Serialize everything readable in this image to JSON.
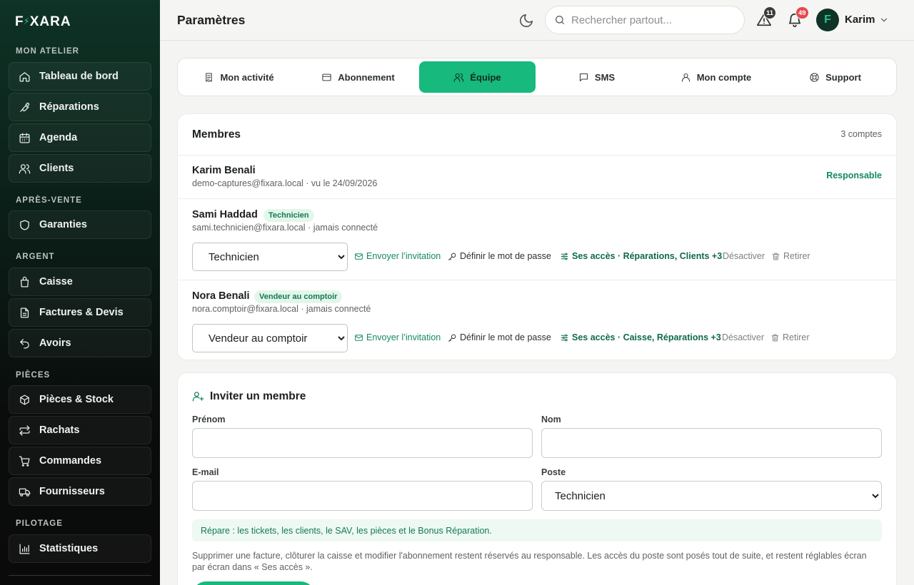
{
  "sidebar": {
    "brand": {
      "left": "F",
      "bolt": "⚡",
      "right": "XARA"
    },
    "sections": [
      {
        "title": "MON ATELIER"
      },
      {
        "title": "APRÈS-VENTE"
      },
      {
        "title": "ARGENT"
      },
      {
        "title": "PIÈCES"
      },
      {
        "title": "PILOTAGE"
      }
    ],
    "items": [
      {
        "label": "Tableau de bord",
        "icon": "home-icon"
      },
      {
        "label": "Réparations",
        "icon": "wrench-icon"
      },
      {
        "label": "Agenda",
        "icon": "calendar-icon"
      },
      {
        "label": "Clients",
        "icon": "users-icon"
      },
      {
        "label": "Garanties",
        "icon": "shield-icon"
      },
      {
        "label": "Caisse",
        "icon": "register-icon"
      },
      {
        "label": "Factures & Devis",
        "icon": "document-icon"
      },
      {
        "label": "Avoirs",
        "icon": "undo-icon"
      },
      {
        "label": "Pièces & Stock",
        "icon": "box-icon"
      },
      {
        "label": "Rachats",
        "icon": "exchange-icon"
      },
      {
        "label": "Commandes",
        "icon": "cart-icon"
      },
      {
        "label": "Fournisseurs",
        "icon": "truck-icon"
      },
      {
        "label": "Statistiques",
        "icon": "bar-chart-icon"
      }
    ]
  },
  "header": {
    "title": "Paramètres",
    "search_placeholder": "Rechercher partout...",
    "alerts_count": "11",
    "notifications_count": "49",
    "user_initial": "F",
    "user_name": "Karim"
  },
  "tabs": [
    {
      "label": "Mon activité",
      "icon": "receipt-icon",
      "active": false
    },
    {
      "label": "Abonnement",
      "icon": "credit-card-icon",
      "active": false
    },
    {
      "label": "Équipe",
      "icon": "team-icon",
      "active": true
    },
    {
      "label": "SMS",
      "icon": "message-icon",
      "active": false
    },
    {
      "label": "Mon compte",
      "icon": "user-icon",
      "active": false
    },
    {
      "label": "Support",
      "icon": "lifebuoy-icon",
      "active": false
    }
  ],
  "members": {
    "title": "Membres",
    "count": "3 comptes",
    "list": [
      {
        "name": "Karim Benali",
        "sub": "demo-captures@fixara.local · vu le 24/09/2026",
        "role": "Responsable"
      },
      {
        "name": "Sami Haddad",
        "badge": "Technicien",
        "sub": "sami.technicien@fixara.local · jamais connecté",
        "poste": "Technicien",
        "access": "Ses accès · Réparations, Clients +3"
      },
      {
        "name": "Nora Benali",
        "badge": "Vendeur au comptoir",
        "sub": "nora.comptoir@fixara.local · jamais connecté",
        "poste": "Vendeur au comptoir",
        "access": "Ses accès · Caisse, Réparations +3"
      }
    ],
    "actions": {
      "invite": "Envoyer l’invitation",
      "password": "Définir le mot de passe",
      "deactivate": "Désactiver",
      "remove": "Retirer"
    },
    "poste_options": [
      "Technicien",
      "Vendeur au comptoir"
    ]
  },
  "invite": {
    "title": "Inviter un membre",
    "first_name_label": "Prénom",
    "last_name_label": "Nom",
    "email_label": "E-mail",
    "poste_label": "Poste",
    "poste_value": "Technicien",
    "info": "Répare : les tickets, les clients, le SAV, les pièces et le Bonus Réparation.",
    "note": "Supprimer une facture, clôturer la caisse et modifier l'abonnement restent réservés au responsable. Les accès du poste sont posés tout de suite, et restent réglables écran par écran dans « Ses accès »."
  },
  "colors": {
    "accent": "#17b97d",
    "accent_text": "#138a5c",
    "sidebar_top": "#0f3326",
    "alert_badge": "#3a3a3a",
    "notif_badge": "#e5484d"
  }
}
